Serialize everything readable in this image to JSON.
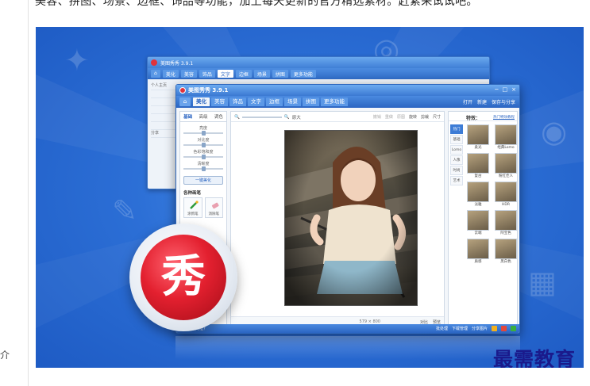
{
  "article": {
    "intro_text": "美容、拼图、场景、边框、饰品等功能，加上每天更新的官方精选素材。赶紧来试试吧。",
    "left_rail_text": "介"
  },
  "back_window": {
    "title": "美图秀秀 3.9.1",
    "tabs": [
      "美化",
      "美容",
      "饰品",
      "文字",
      "边框",
      "场景",
      "拼图",
      "更多功能"
    ],
    "active_tab": 3,
    "side_items": [
      "个人主页",
      "",
      "",
      "",
      "",
      "",
      "分享"
    ]
  },
  "app": {
    "title": "美图秀秀 3.9.1",
    "window_controls": [
      "─",
      "□",
      "×"
    ],
    "tabs": [
      "美化",
      "美容",
      "饰品",
      "文字",
      "边框",
      "场景",
      "拼图",
      "更多功能"
    ],
    "active_tab": 0,
    "toolbar_right": [
      "打开",
      "新建",
      "保存与分享"
    ]
  },
  "left_panel": {
    "subtabs": [
      "基础",
      "高级",
      "调色"
    ],
    "sliders": [
      {
        "label": "亮度",
        "value": 0.5
      },
      {
        "label": "对比度",
        "value": 0.5
      },
      {
        "label": "色彩饱和度",
        "value": 0.5
      },
      {
        "label": "清晰度",
        "value": 0.5
      }
    ],
    "one_key_button": "一键美化",
    "pens_title": "各种画笔",
    "pens": [
      "涂鸦笔",
      "消除笔"
    ]
  },
  "canvas": {
    "zoom_label": "原大",
    "actions": [
      "撤销",
      "重做",
      "原图",
      "旋转",
      "剪裁",
      "尺寸"
    ],
    "dimensions": "579 × 800",
    "status_options": [
      "对比",
      "预览"
    ]
  },
  "effects": {
    "title": "特效：",
    "link": "热门特效教程",
    "categories": [
      "热门",
      "基础",
      "Lomo",
      "人像",
      "时尚",
      "艺术"
    ],
    "active_category": 0,
    "items": [
      "柔光",
      "经典Lomo",
      "复古",
      "粉红佳人",
      "淡雅",
      "HDR",
      "云端",
      "阿宝色",
      "质感",
      "黑白色"
    ]
  },
  "bottom_bar": {
    "left_text": "你的美图网址？",
    "right_items": [
      "批处理",
      "下载管理",
      "分享图片"
    ]
  },
  "brand": {
    "logo_char": "秀",
    "watermark": "最需教育"
  },
  "colors": {
    "banner_blue": "#2c6fd6",
    "titlebar_blue": "#3b79d2",
    "logo_red": "#e3202f",
    "watermark_navy": "#1a1a8c"
  }
}
